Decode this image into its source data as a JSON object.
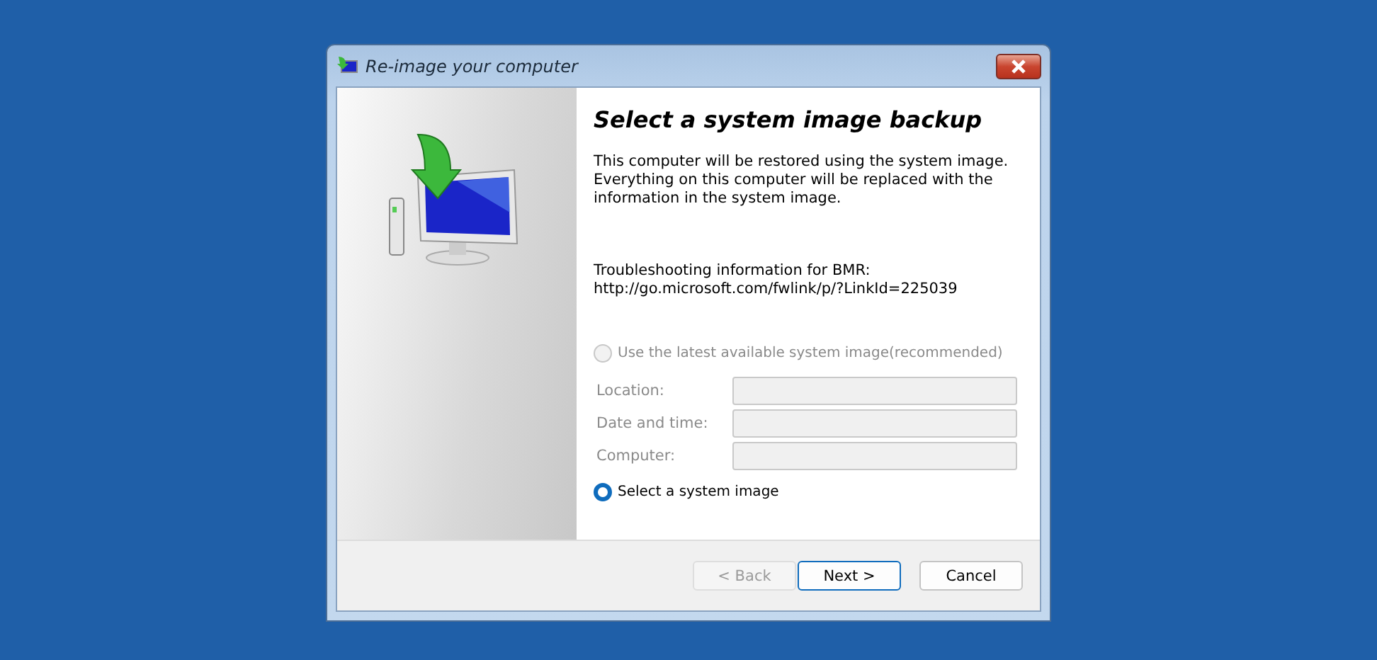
{
  "window": {
    "title": "Re-image your computer"
  },
  "heading": "Select a system image backup",
  "description": "This computer will be restored using the system image. Everything on this computer will be replaced with the information in the system image.",
  "troubleshooting": [
    "Troubleshooting information for BMR:",
    "http://go.microsoft.com/fwlink/p/?LinkId=225039"
  ],
  "options": [
    {
      "label": "Use the latest available system image(recommended)",
      "selected": false,
      "disabled": true,
      "fields": [
        {
          "label": "Location:"
        },
        {
          "label": "Date and time:"
        },
        {
          "label": "Computer:"
        }
      ]
    },
    {
      "label": "Select a system image",
      "selected": true,
      "disabled": false
    }
  ],
  "buttons": [
    {
      "label": "< Back",
      "disabled": true,
      "default": false
    },
    {
      "label": "Next >",
      "disabled": false,
      "default": true
    },
    {
      "label": "Cancel",
      "disabled": false,
      "default": false
    }
  ]
}
